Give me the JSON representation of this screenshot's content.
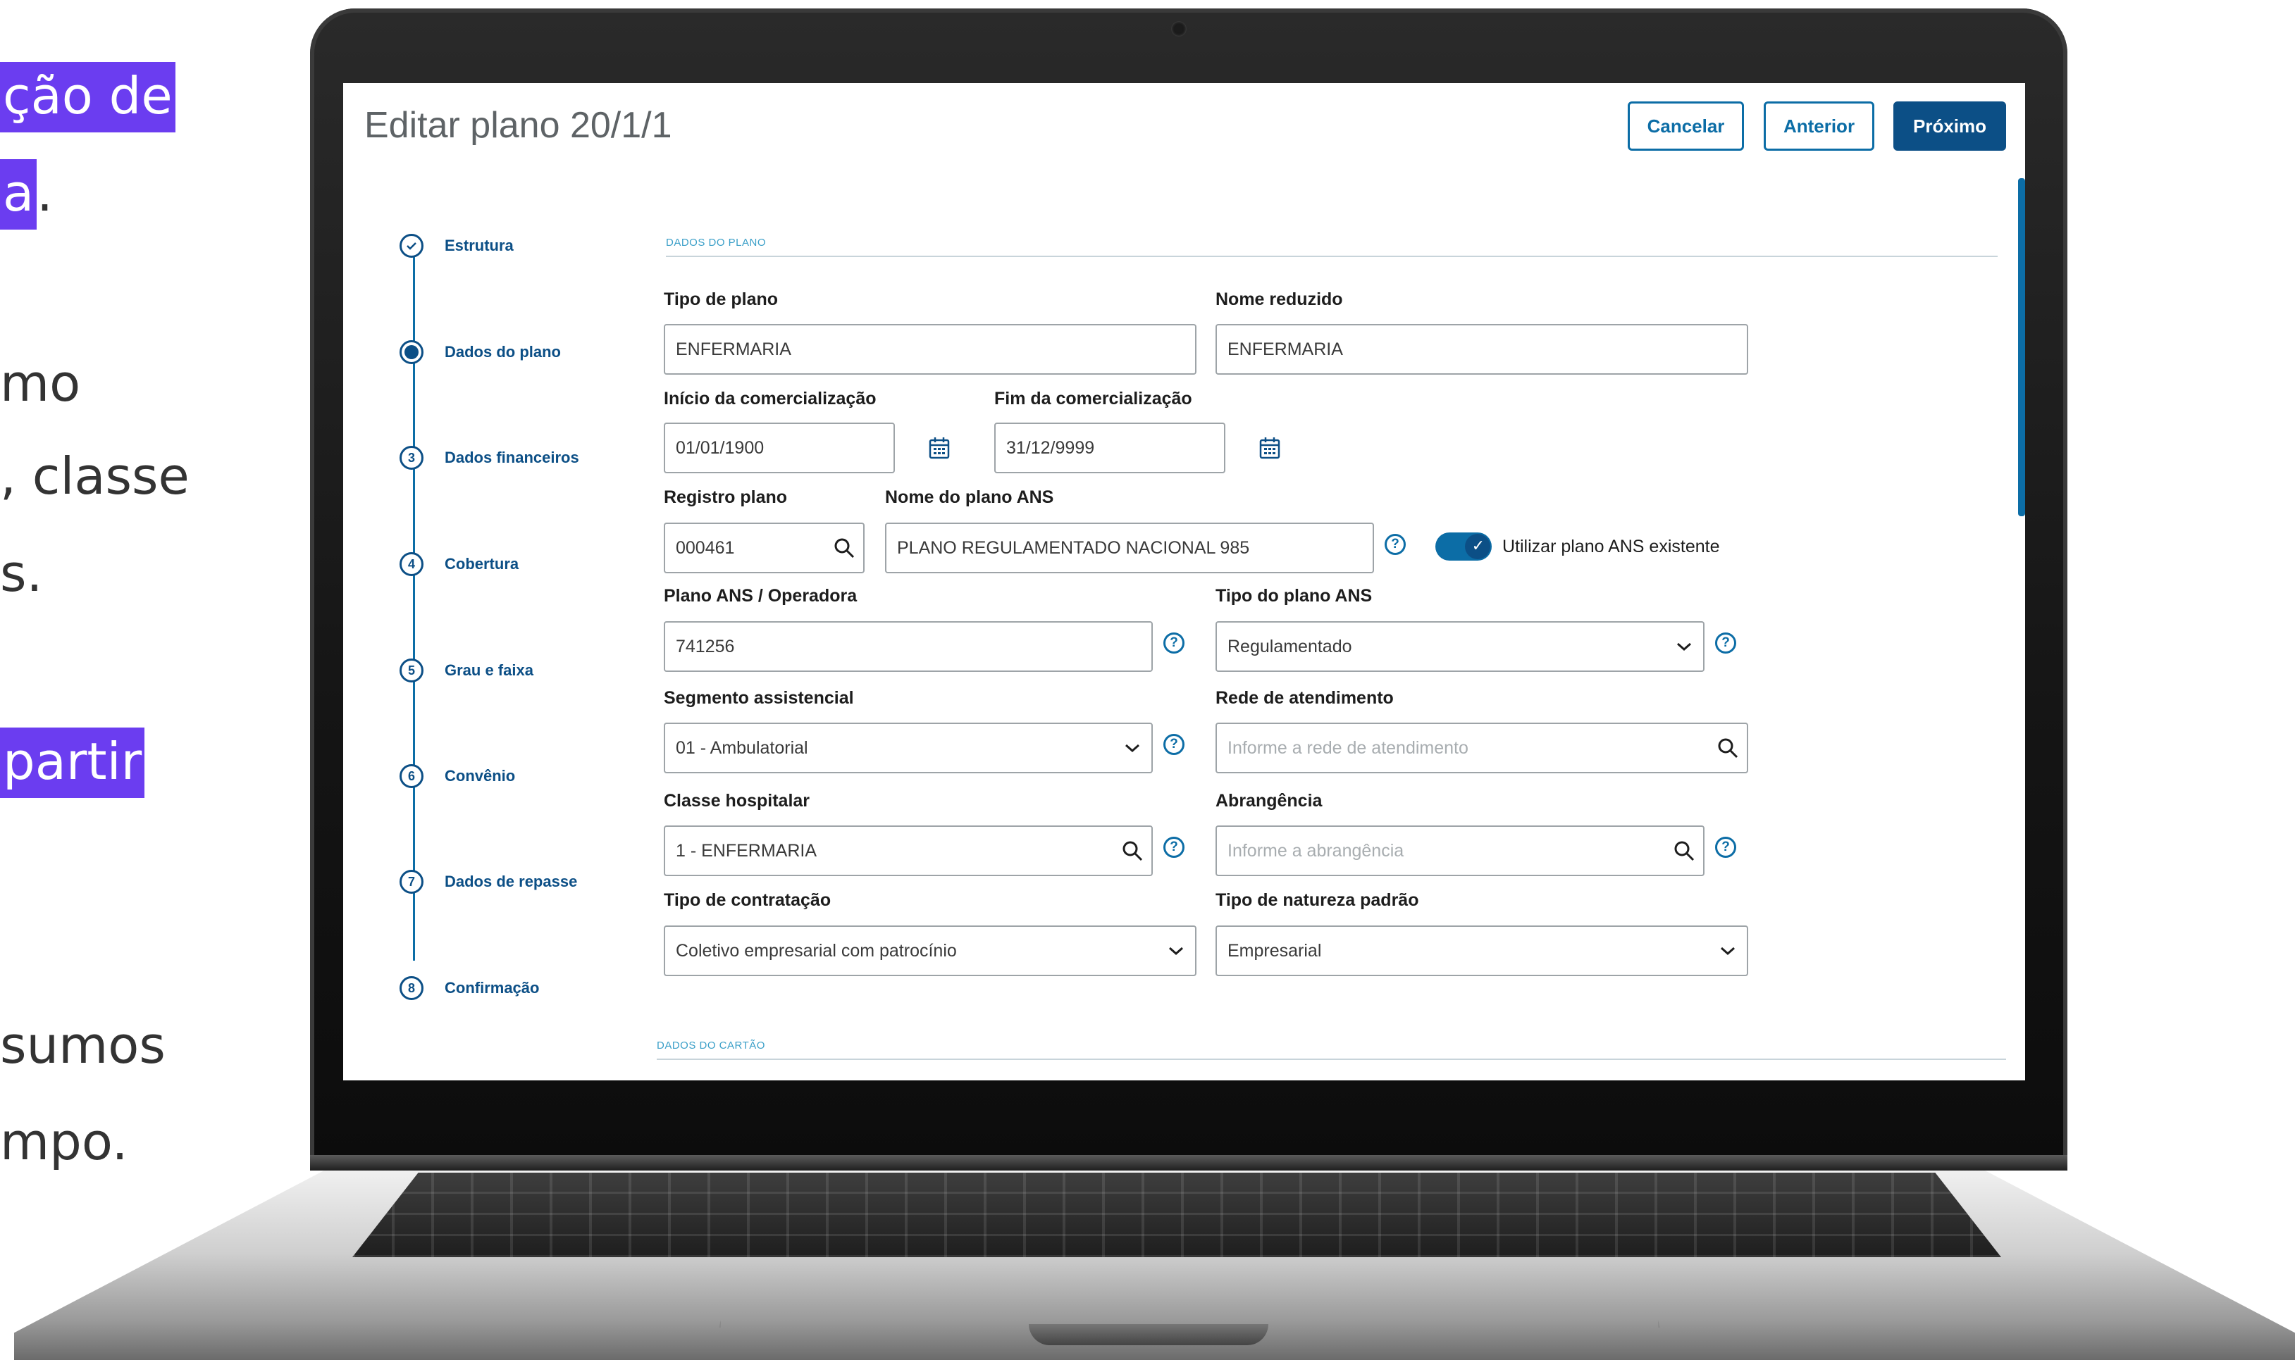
{
  "slide": {
    "fragments": [
      "ção de",
      "a",
      ".",
      "mo",
      ", classe",
      "s.",
      "partir",
      "sumos",
      "mpo."
    ]
  },
  "app": {
    "title": "Editar plano 20/1/1",
    "buttons": {
      "cancel": "Cancelar",
      "previous": "Anterior",
      "next": "Próximo"
    }
  },
  "stepper": {
    "steps": [
      {
        "number": "✓",
        "label": "Estrutura",
        "state": "done"
      },
      {
        "number": "",
        "label": "Dados do plano",
        "state": "active"
      },
      {
        "number": "3",
        "label": "Dados financeiros",
        "state": "pending"
      },
      {
        "number": "4",
        "label": "Cobertura",
        "state": "pending"
      },
      {
        "number": "5",
        "label": "Grau e faixa",
        "state": "pending"
      },
      {
        "number": "6",
        "label": "Convênio",
        "state": "pending"
      },
      {
        "number": "7",
        "label": "Dados de repasse",
        "state": "pending"
      },
      {
        "number": "8",
        "label": "Confirmação",
        "state": "pending"
      }
    ]
  },
  "form": {
    "section_plan": "DADOS DO PLANO",
    "section_card": "DADOS DO CARTÃO",
    "tipo_plano": {
      "label": "Tipo de plano",
      "value": "ENFERMARIA"
    },
    "nome_reduzido": {
      "label": "Nome reduzido",
      "value": "ENFERMARIA"
    },
    "inicio_comercializacao": {
      "label": "Início da comercialização",
      "value": "01/01/1900"
    },
    "fim_comercializacao": {
      "label": "Fim da comercialização",
      "value": "31/12/9999"
    },
    "registro_plano": {
      "label": "Registro plano",
      "value": "000461"
    },
    "nome_plano_ans": {
      "label": "Nome do plano ANS",
      "value": "PLANO REGULAMENTADO NACIONAL 985"
    },
    "utilizar_plano_ans": {
      "label": "Utilizar plano ANS existente",
      "checked": true
    },
    "plano_ans_operadora": {
      "label": "Plano ANS / Operadora",
      "value": "741256"
    },
    "tipo_plano_ans": {
      "label": "Tipo do plano ANS",
      "value": "Regulamentado"
    },
    "segmento_assistencial": {
      "label": "Segmento assistencial",
      "value": "01 - Ambulatorial"
    },
    "rede_atendimento": {
      "label": "Rede de atendimento",
      "placeholder": "Informe a rede de atendimento"
    },
    "classe_hospitalar": {
      "label": "Classe hospitalar",
      "value": "1 - ENFERMARIA"
    },
    "abrangencia": {
      "label": "Abrangência",
      "placeholder": "Informe a abrangência"
    },
    "tipo_contratacao": {
      "label": "Tipo de contratação",
      "value": "Coletivo empresarial com patrocínio"
    },
    "tipo_natureza_padrao": {
      "label": "Tipo de natureza padrão",
      "value": "Empresarial"
    }
  },
  "colors": {
    "primary": "#0c4f86",
    "accent": "#0c6da6",
    "highlight": "#6b3df0"
  }
}
